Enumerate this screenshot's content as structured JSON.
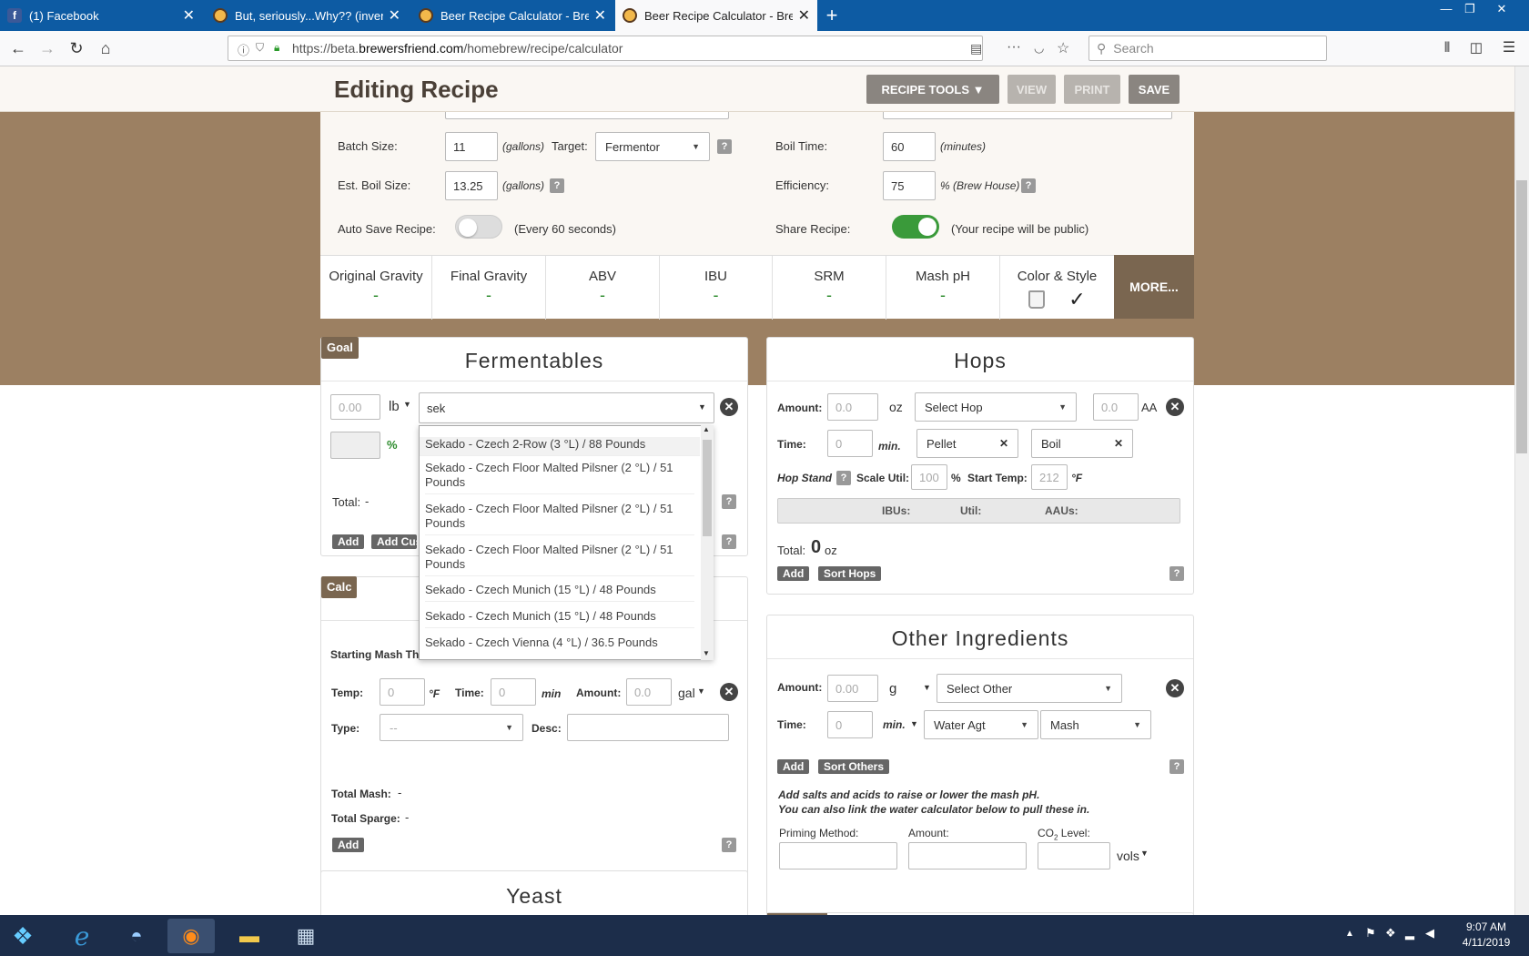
{
  "browser": {
    "tabs": [
      {
        "title": "(1) Facebook",
        "icon": "facebook-icon"
      },
      {
        "title": "But, seriously...Why?? (inventor",
        "icon": "brewersfriend-icon"
      },
      {
        "title": "Beer Recipe Calculator - Brewe",
        "icon": "brewersfriend-icon"
      },
      {
        "title": "Beer Recipe Calculator - Brewe",
        "icon": "brewersfriend-icon",
        "active": true
      }
    ],
    "url_prefix": "https://beta.",
    "url_domain": "brewersfriend.com",
    "url_path": "/homebrew/recipe/calculator",
    "search_placeholder": "Search"
  },
  "header": {
    "title": "Editing Recipe",
    "recipe_tools": "RECIPE TOOLS ▼",
    "view": "VIEW",
    "print": "PRINT",
    "save": "SAVE"
  },
  "settings": {
    "batch_size_label": "Batch Size:",
    "batch_size": "11",
    "gallons": "(gallons)",
    "target_label": "Target:",
    "target": "Fermentor",
    "boil_time_label": "Boil Time:",
    "boil_time": "60",
    "minutes": "(minutes)",
    "est_boil_label": "Est. Boil Size:",
    "est_boil": "13.25",
    "efficiency_label": "Efficiency:",
    "efficiency": "75",
    "brew_house": "% (Brew House)",
    "auto_save_label": "Auto Save Recipe:",
    "auto_save_note": "(Every 60 seconds)",
    "share_label": "Share Recipe:",
    "share_note": "(Your recipe will be public)"
  },
  "stats": [
    {
      "name": "Original Gravity",
      "value": "-"
    },
    {
      "name": "Final Gravity",
      "value": "-"
    },
    {
      "name": "ABV",
      "value": "-"
    },
    {
      "name": "IBU",
      "value": "-"
    },
    {
      "name": "SRM",
      "value": "-"
    },
    {
      "name": "Mash pH",
      "value": "-"
    },
    {
      "name": "Color & Style",
      "value": "✓"
    }
  ],
  "more": "MORE...",
  "fermentables": {
    "badge": "Goal",
    "title": "Fermentables",
    "amount_placeholder": "0.00",
    "unit": "lb",
    "search": "sek",
    "percent": "%",
    "total": "Total:",
    "total_value": "-",
    "add": "Add",
    "add_custom": "Add Cus",
    "options": [
      "Sekado - Czech 2-Row (3 °L) / 88 Pounds",
      "Sekado - Czech Floor Malted Pilsner (2 °L) / 51 Pounds",
      "Sekado - Czech Floor Malted Pilsner (2 °L) / 51 Pounds",
      "Sekado - Czech Floor Malted Pilsner (2 °L) / 51 Pounds",
      "Sekado - Czech Munich (15 °L) / 48 Pounds",
      "Sekado - Czech Munich (15 °L) / 48 Pounds",
      "Sekado - Czech Vienna (4 °L) / 36.5 Pounds"
    ]
  },
  "mash": {
    "badge": "Calc",
    "starting_label": "Starting Mash Th",
    "temp_label": "Temp:",
    "temp_placeholder": "0",
    "temp_unit": "°F",
    "time_label": "Time:",
    "time_placeholder": "0",
    "time_unit": "min",
    "amount_label": "Amount:",
    "amount_placeholder": "0.0",
    "amount_unit": "gal",
    "type_label": "Type:",
    "type_value": "--",
    "desc_label": "Desc:",
    "total_mash": "Total Mash:",
    "total_mash_value": "-",
    "total_sparge": "Total Sparge:",
    "total_sparge_value": "-",
    "add": "Add"
  },
  "hops": {
    "title": "Hops",
    "amount_label": "Amount:",
    "amount_placeholder": "0.0",
    "unit": "oz",
    "select": "Select Hop",
    "aa_placeholder": "0.0",
    "aa": "AA",
    "time_label": "Time:",
    "time_placeholder": "0",
    "time_unit": "min.",
    "form": "Pellet",
    "use": "Boil",
    "hop_stand": "Hop Stand",
    "scale_util": "Scale Util:",
    "scale_value": "100",
    "pct": "%",
    "start_temp": "Start Temp:",
    "start_temp_value": "212",
    "temp_unit": "°F",
    "ibus": "IBUs:",
    "util": "Util:",
    "aaus": "AAUs:",
    "total_label": "Total:",
    "total_value": "0",
    "total_unit": "oz",
    "add": "Add",
    "sort": "Sort Hops"
  },
  "other": {
    "title": "Other Ingredients",
    "amount_label": "Amount:",
    "amount_placeholder": "0.00",
    "unit": "g",
    "select": "Select Other",
    "time_label": "Time:",
    "time_placeholder": "0",
    "time_unit": "min.",
    "type": "Water Agt",
    "use": "Mash",
    "add": "Add",
    "sort": "Sort Others",
    "note1": "Add salts and acids to raise or lower the mash pH.",
    "note2": "You can also link the water calculator below to pull these in.",
    "priming_label": "Priming Method:",
    "priming_amount_label": "Amount:",
    "co2_label": "CO",
    "co2_sub": "2",
    "co2_rest": " Level:",
    "vols": "vols"
  },
  "yeast": {
    "title": "Yeast"
  },
  "taskbar": {
    "time": "9:07 AM",
    "date": "4/11/2019"
  },
  "colors": {
    "accent": "#7a6650",
    "tabbar": "#0d5ba3",
    "toggle_on": "#3a9a3a",
    "band": "#9c8062"
  }
}
